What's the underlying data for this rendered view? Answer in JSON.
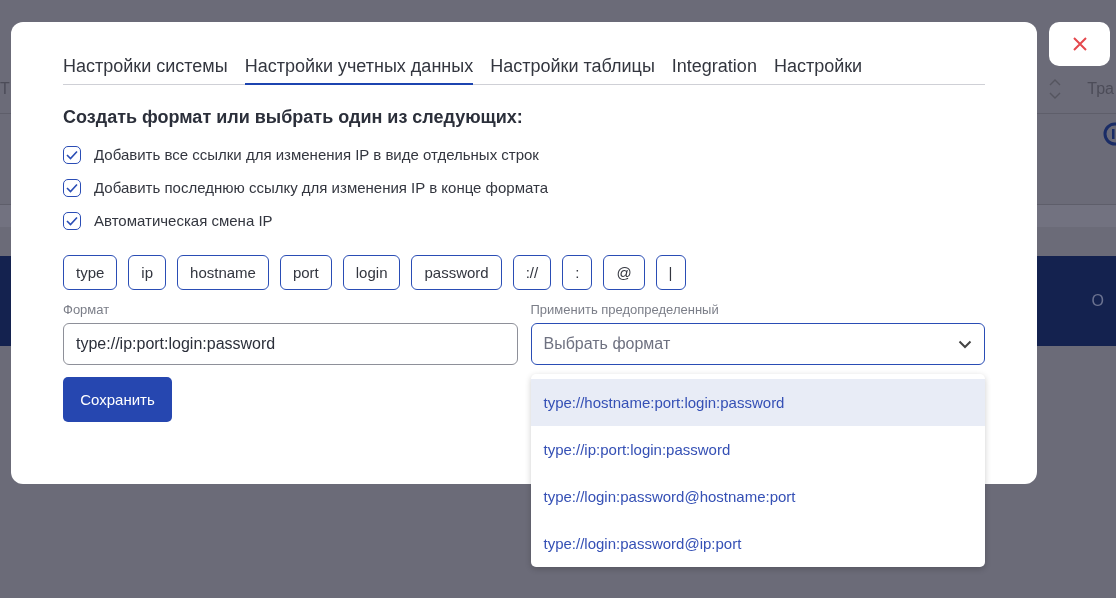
{
  "background": {
    "column_headers": [
      "Т",
      "Тра"
    ],
    "banner_text": "О"
  },
  "modal": {
    "tabs": [
      {
        "label": "Настройки системы",
        "selected": false
      },
      {
        "label": "Настройки учетных данных",
        "selected": true
      },
      {
        "label": "Настройки таблицы",
        "selected": false
      },
      {
        "label": "Integration",
        "selected": false
      },
      {
        "label": "Настройки",
        "selected": false
      }
    ],
    "heading": "Создать формат или выбрать один из следующих:",
    "options": [
      {
        "label": "Добавить все ссылки для изменения IP в виде отдельных строк",
        "checked": true
      },
      {
        "label": "Добавить последнюю ссылку для изменения IP в конце формата",
        "checked": true
      },
      {
        "label": "Автоматическая смена IP",
        "checked": true
      }
    ],
    "tokens": [
      "type",
      "ip",
      "hostname",
      "port",
      "login",
      "password",
      "://",
      ":",
      "@",
      "|"
    ],
    "format_field": {
      "label": "Формат",
      "value": "type://ip:port:login:password"
    },
    "preset_select": {
      "label": "Применить предопределенный",
      "placeholder": "Выбрать формат",
      "expanded": true
    },
    "preset_options": [
      {
        "label": "type://hostname:port:login:password",
        "selected": true
      },
      {
        "label": "type://ip:port:login:password",
        "selected": false
      },
      {
        "label": "type://login:password@hostname:port",
        "selected": false
      },
      {
        "label": "type://login:password@ip:port",
        "selected": false
      }
    ],
    "save_button": "Сохранить"
  }
}
